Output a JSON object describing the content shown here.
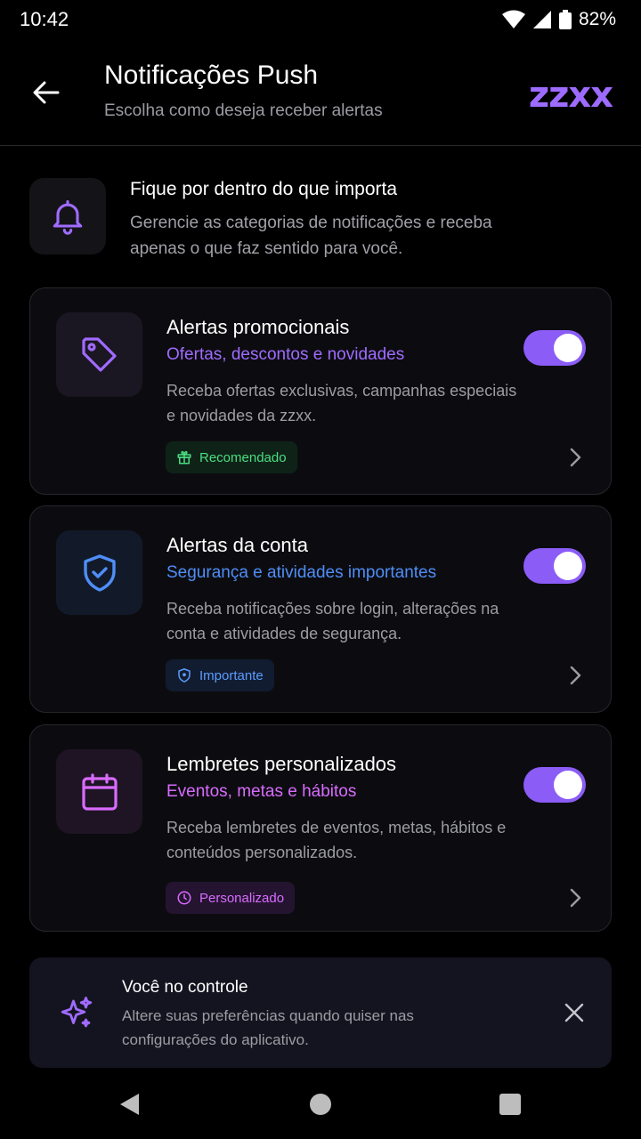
{
  "status_bar": {
    "time": "10:42",
    "battery": "82%"
  },
  "header": {
    "title": "Notificações Push",
    "subtitle": "Escolha como deseja receber alertas",
    "brand": "zzxx"
  },
  "intro": {
    "title": "Fique por dentro do que importa",
    "text": "Gerencie as categorias de notificações e receba apenas o que faz sentido para você."
  },
  "cards": [
    {
      "title": "Alertas promocionais",
      "subtitle": "Ofertas, descontos e novidades",
      "description": "Receba ofertas exclusivas, campanhas especiais e novidades da zzxx.",
      "badge": "Recomendado",
      "enabled": true,
      "icon": "tag-icon",
      "accent": "#a06bff",
      "badge_color": "#4ade80"
    },
    {
      "title": "Alertas da conta",
      "subtitle": "Segurança e atividades importantes",
      "description": "Receba notificações sobre login, alterações na conta e atividades de segurança.",
      "badge": "Importante",
      "enabled": true,
      "icon": "shield-icon",
      "accent": "#4f8ef7",
      "badge_color": "#5b9cff"
    },
    {
      "title": "Lembretes personalizados",
      "subtitle": "Eventos, metas e hábitos",
      "description": "Receba lembretes de eventos, metas, hábitos e conteúdos personalizados.",
      "badge": "Personalizado",
      "enabled": true,
      "icon": "calendar-icon",
      "accent": "#d96bff",
      "badge_color": "#d96bff"
    }
  ],
  "info_banner": {
    "title": "Você no controle",
    "text": "Altere suas preferências quando quiser nas configurações do aplicativo."
  },
  "colors": {
    "toggle_on": "#8b5cf6",
    "brand": "#9d6bff"
  }
}
